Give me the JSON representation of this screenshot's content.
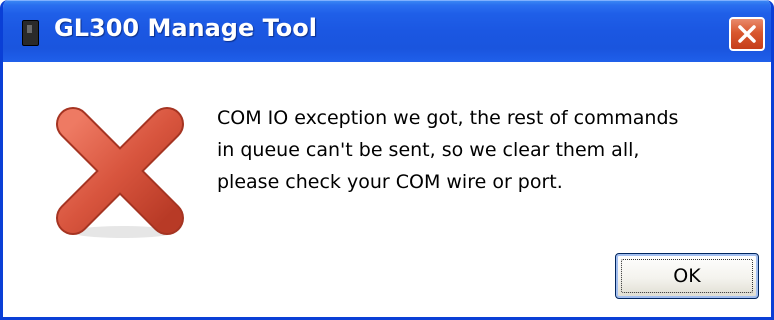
{
  "window": {
    "title": "GL300 Manage Tool"
  },
  "icons": {
    "app": "app-icon",
    "close": "close-icon",
    "error": "error-x-icon"
  },
  "message": {
    "lines": [
      "COM IO exception we got, the rest of commands",
      "in queue can't be sent, so we clear them all,",
      "please check your COM wire or port."
    ]
  },
  "buttons": {
    "ok_label": "OK"
  },
  "colors": {
    "titlebar": "#1b57e2",
    "close_button": "#d9582f",
    "error_x": "#d8553e"
  }
}
